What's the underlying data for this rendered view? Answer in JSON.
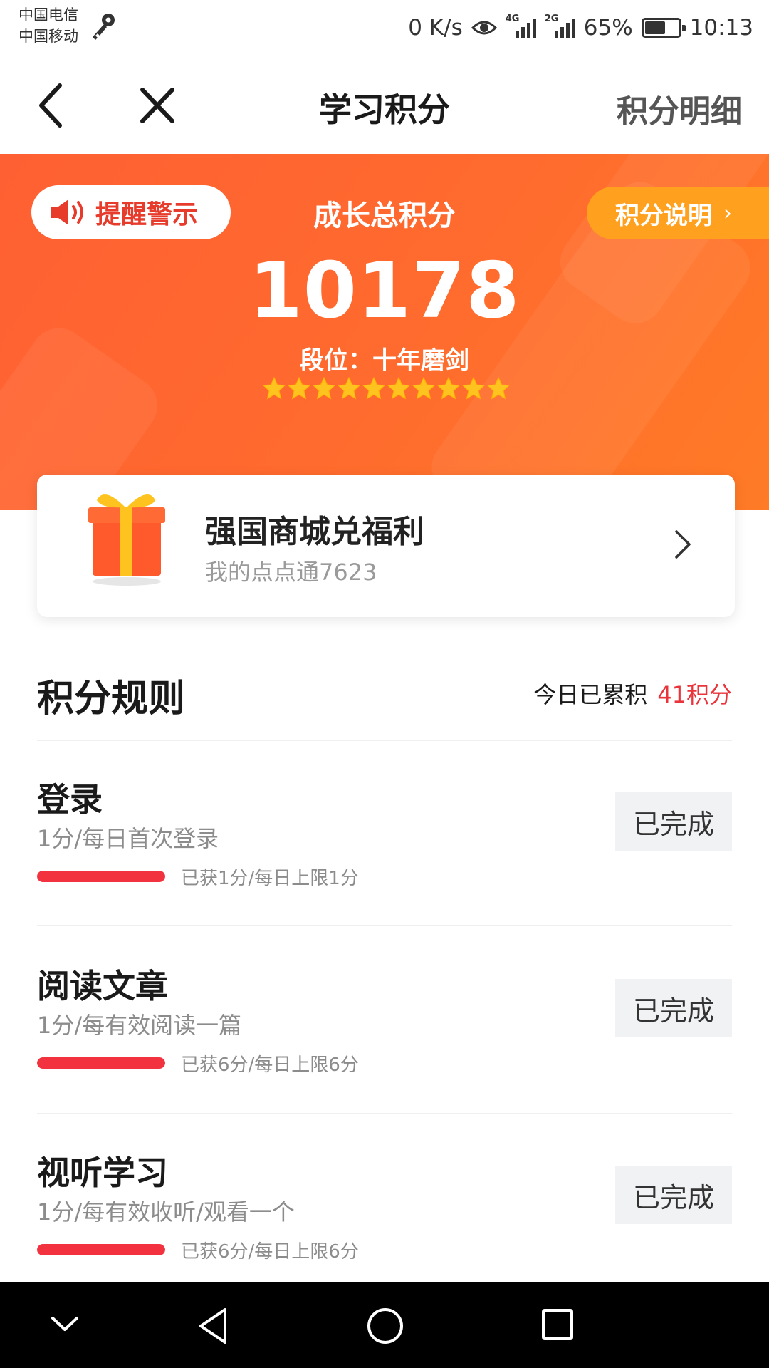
{
  "status_bar": {
    "carrier1": "中国电信",
    "carrier2": "中国移动",
    "net_speed": "0 K/s",
    "net1": "4G",
    "net2": "2G",
    "battery": "65%",
    "battery_level": 0.65,
    "time": "10:13"
  },
  "nav": {
    "title": "学习积分",
    "detail_label": "积分明细"
  },
  "hero": {
    "alert_label": "提醒警示",
    "total_label": "成长总积分",
    "score": "10178",
    "rank": "段位：十年磨剑",
    "stars": 10,
    "explain_label": "积分说明",
    "explain_chevron": "›"
  },
  "mall": {
    "title": "强国商城兑福利",
    "subtitle": "我的点点通7623"
  },
  "rules": {
    "title": "积分规则",
    "today_label": "今日已累积",
    "today_points": "41积分"
  },
  "tasks": [
    {
      "name": "登录",
      "desc": "1分/每日首次登录",
      "progress": "已获1分/每日上限1分",
      "fill": 1.0,
      "button": "已完成"
    },
    {
      "name": "阅读文章",
      "desc": "1分/每有效阅读一篇",
      "progress": "已获6分/每日上限6分",
      "fill": 1.0,
      "button": "已完成"
    },
    {
      "name": "视听学习",
      "desc": "1分/每有效收听/观看一个",
      "progress": "已获6分/每日上限6分",
      "fill": 1.0,
      "button": "已完成"
    }
  ],
  "colors": {
    "hero_orange": "#ff6a2e",
    "explain_pill": "#ffa11e",
    "accent_red": "#e8343a",
    "progress_red": "#f2323e",
    "star_gold": "#ffc31f"
  },
  "icons": [
    "key-icon",
    "eye-icon",
    "back-icon",
    "close-icon",
    "speaker-icon",
    "star-icon",
    "gift-icon",
    "chevron-right-icon",
    "nav-back-triangle-icon",
    "nav-home-circle-icon",
    "nav-recents-square-icon",
    "nav-down-chevron-icon"
  ]
}
